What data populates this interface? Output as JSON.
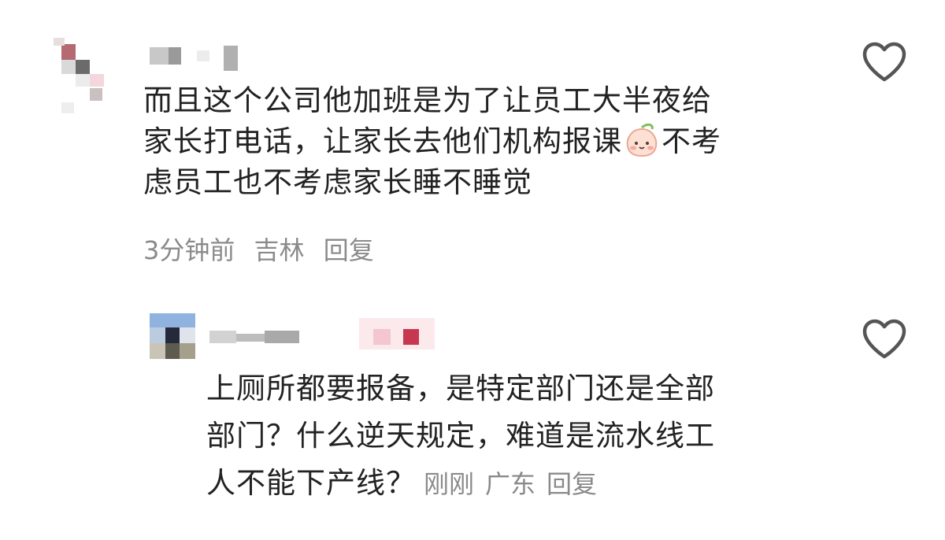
{
  "comments": [
    {
      "text_line1": "而且这个公司他加班是为了让员工大半夜给",
      "text_line2a": "家长打电话，让家长去他们机构报课",
      "emoji_icon": "peach-face-emoji",
      "text_line2b": "不考",
      "text_line3": "虑员工也不考虑家长睡不睡觉",
      "time": "3分钟前",
      "location": "吉林",
      "reply_label": "回复",
      "like_icon": "heart-outline-icon"
    },
    {
      "text_line1": "上厕所都要报备，是特定部门还是全部",
      "text_line2": "部门？什么逆天规定，难道是流水线工",
      "text_line3": "人不能下产线？",
      "time": "刚刚",
      "location": "广东",
      "reply_label": "回复",
      "like_icon": "heart-outline-icon"
    }
  ],
  "colors": {
    "text": "#222222",
    "meta": "#8a8a8a",
    "heart_stroke": "#555555"
  }
}
